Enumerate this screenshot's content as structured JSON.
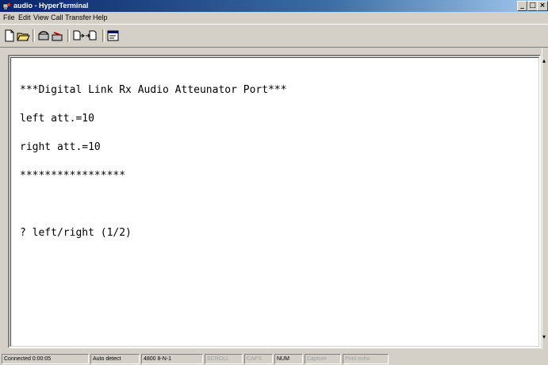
{
  "window": {
    "title": "audio - HyperTerminal",
    "controls": [
      "_",
      "□",
      "×"
    ]
  },
  "menu": [
    "File",
    "Edit",
    "View",
    "Call",
    "Transfer",
    "Help"
  ],
  "terminal": {
    "lines": [
      "***Digital Link Rx Audio Atteunator Port***",
      "left att.=10",
      "right att.=10",
      "*****************",
      "",
      "? left/right (1/2)"
    ]
  },
  "status": {
    "connected": "Connected 0:00:05",
    "detect": "Auto detect",
    "settings": "4800 8-N-1",
    "scroll": "SCROLL",
    "caps": "CAPS",
    "num": "NUM",
    "capture": "Capture",
    "print_echo": "Print echo"
  }
}
